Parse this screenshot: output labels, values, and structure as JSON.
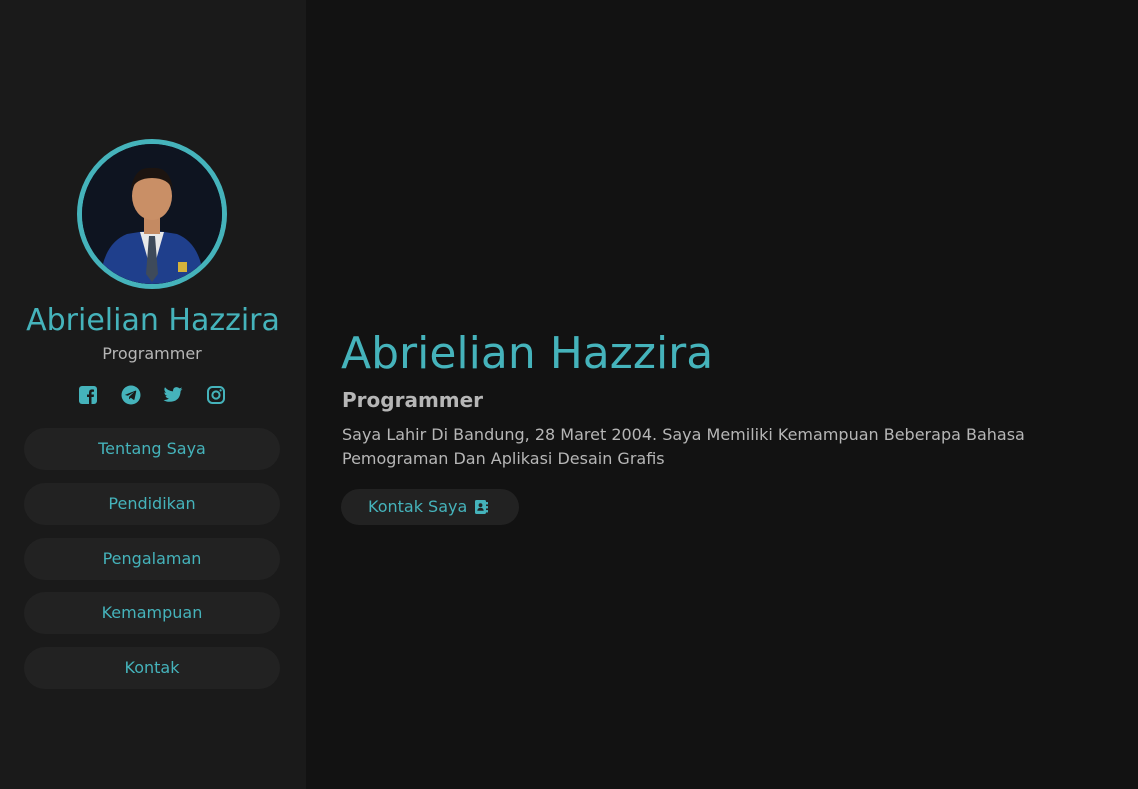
{
  "profile": {
    "name": "Abrielian Hazzira",
    "role": "Programmer",
    "avatar_icon": "profile-photo"
  },
  "social": [
    {
      "icon": "facebook-icon"
    },
    {
      "icon": "telegram-icon"
    },
    {
      "icon": "twitter-icon"
    },
    {
      "icon": "instagram-icon"
    }
  ],
  "nav": {
    "items": [
      {
        "label": "Tentang Saya"
      },
      {
        "label": "Pendidikan"
      },
      {
        "label": "Pengalaman"
      },
      {
        "label": "Kemampuan"
      },
      {
        "label": "Kontak"
      }
    ]
  },
  "hero": {
    "name": "Abrielian Hazzira",
    "role": "Programmer",
    "description": "Saya Lahir Di Bandung, 28 Maret 2004. Saya Memiliki Kemampuan Beberapa Bahasa Pemograman Dan Aplikasi Desain Grafis",
    "button_label": "Kontak Saya",
    "button_icon": "address-book-icon"
  },
  "colors": {
    "accent": "#45b3bb",
    "sidebar_bg": "#1a1a1a",
    "main_bg": "#121212",
    "pill_bg": "#222222",
    "muted_text": "#b6b6b6"
  }
}
